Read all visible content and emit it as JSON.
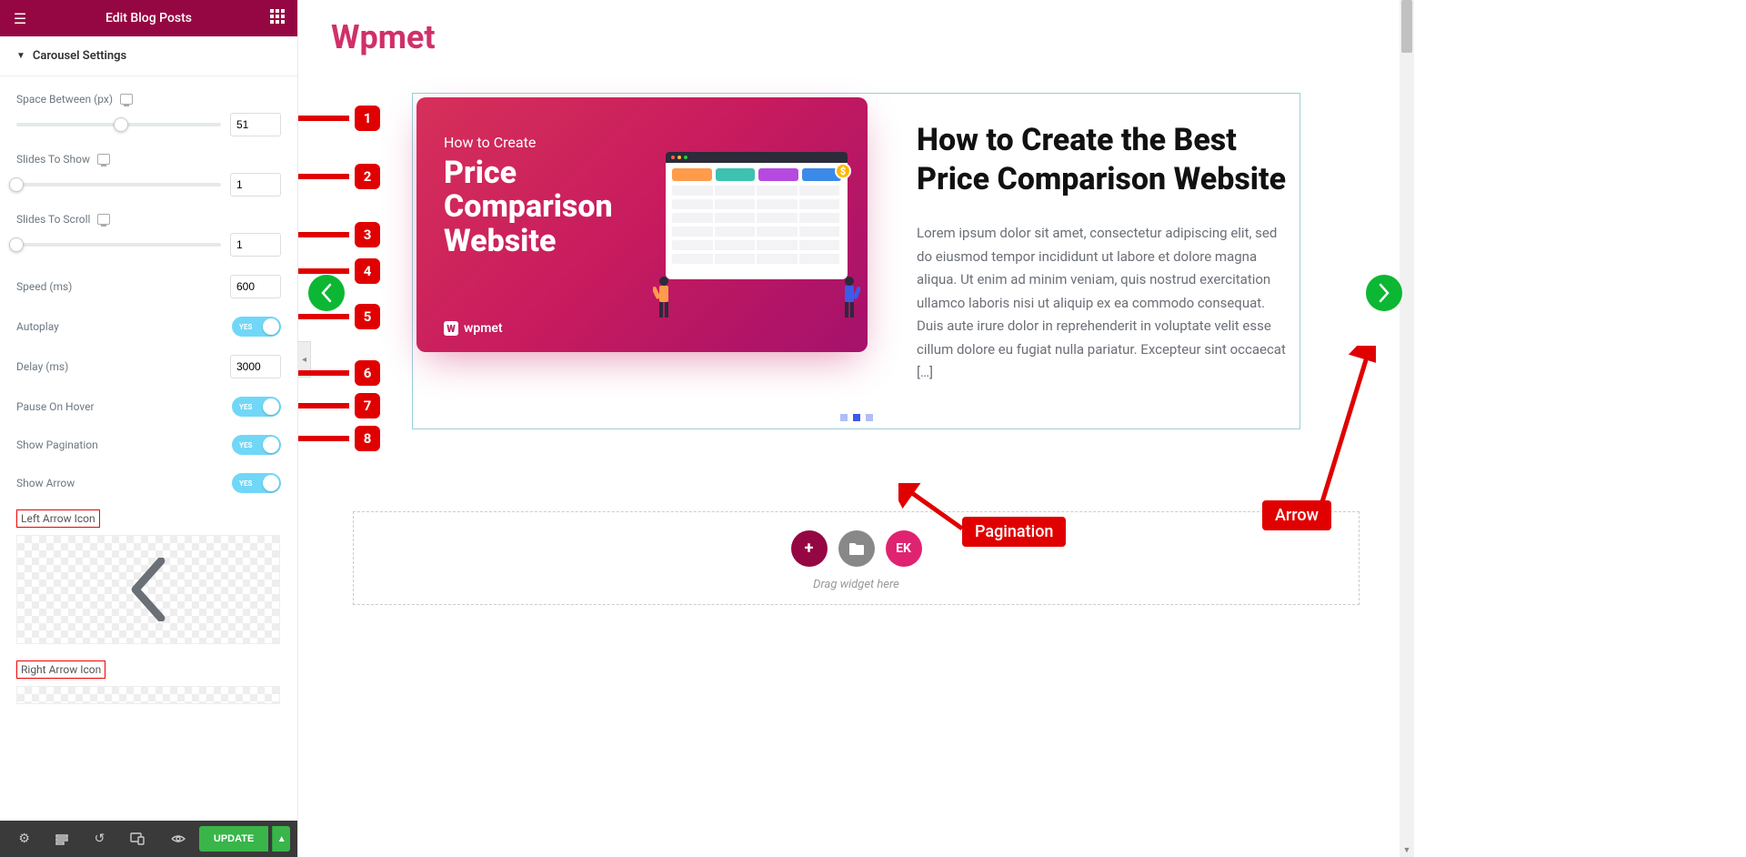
{
  "header": {
    "title": "Edit Blog Posts"
  },
  "section": {
    "title": "Carousel Settings"
  },
  "controls": {
    "space_between": {
      "label": "Space Between (px)",
      "value": "51",
      "pos": 51
    },
    "slides_to_show": {
      "label": "Slides To Show",
      "value": "1",
      "pos": 0
    },
    "slides_to_scroll": {
      "label": "Slides To Scroll",
      "value": "1",
      "pos": 0
    },
    "speed": {
      "label": "Speed (ms)",
      "value": "600"
    },
    "autoplay": {
      "label": "Autoplay",
      "toggle": "YES"
    },
    "delay": {
      "label": "Delay (ms)",
      "value": "3000"
    },
    "pause_on_hover": {
      "label": "Pause On Hover",
      "toggle": "YES"
    },
    "show_pagination": {
      "label": "Show Pagination",
      "toggle": "YES"
    },
    "show_arrow": {
      "label": "Show Arrow",
      "toggle": "YES"
    },
    "left_arrow_label": "Left Arrow Icon",
    "right_arrow_label": "Right Arrow Icon"
  },
  "footer": {
    "update": "UPDATE"
  },
  "brand": "Wpmet",
  "slide": {
    "img_sub": "How to Create",
    "img_title_l1": "Price",
    "img_title_l2": "Comparison",
    "img_title_l3": "Website",
    "img_logo": "wpmet",
    "title": "How to Create the Best Price Comparison Website",
    "body": "Lorem ipsum dolor sit amet, consectetur adipiscing elit, sed do eiusmod tempor incididunt ut labore et dolore magna aliqua. Ut enim ad minim veniam, quis nostrud exercitation ullamco laboris nisi ut aliquip ex ea commodo consequat. Duis aute irure dolor in reprehenderit in voluptate velit esse cillum dolore eu fugiat nulla pariatur. Excepteur sint occaecat […]"
  },
  "dropzone": {
    "text": "Drag widget here",
    "ek": "EK"
  },
  "annotations": {
    "n1": "1",
    "n2": "2",
    "n3": "3",
    "n4": "4",
    "n5": "5",
    "n6": "6",
    "n7": "7",
    "n8": "8",
    "pagination": "Pagination",
    "arrow": "Arrow"
  }
}
